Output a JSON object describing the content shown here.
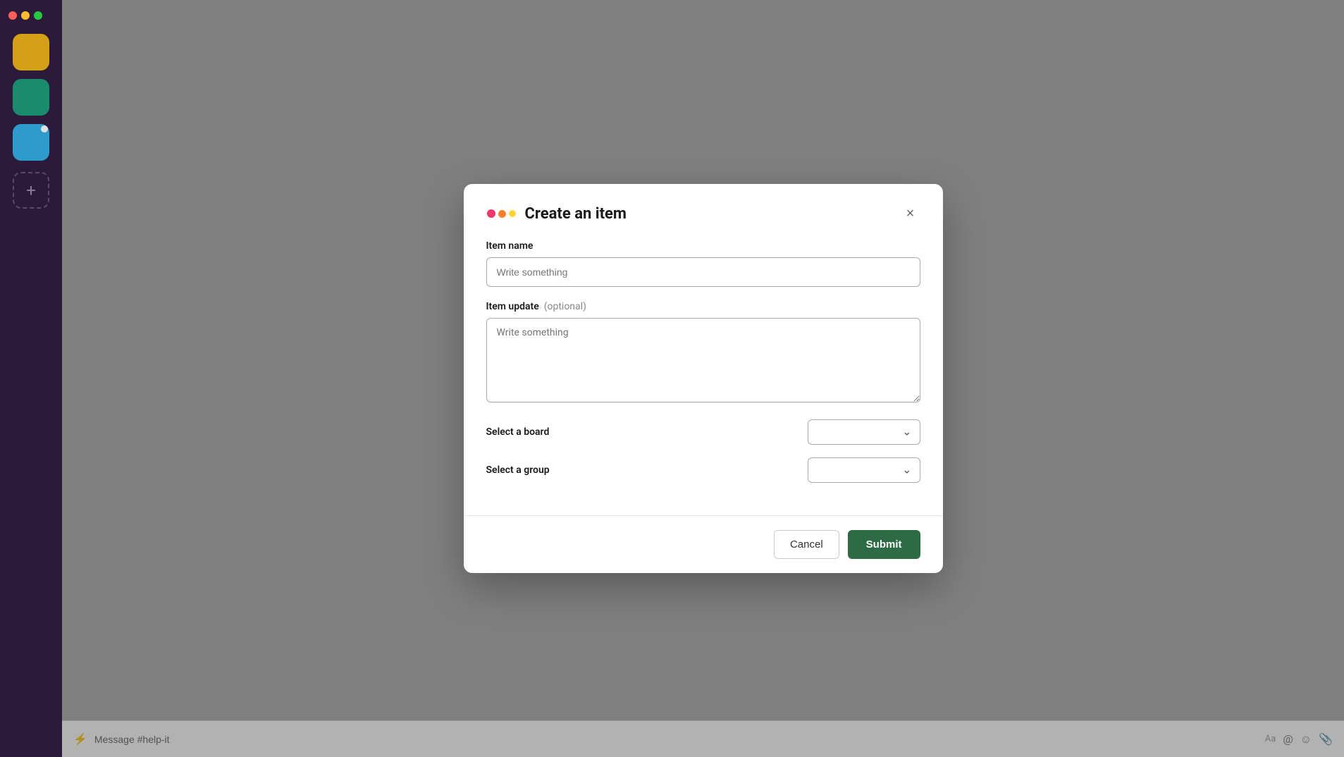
{
  "sidebar": {
    "icons": [
      {
        "id": "icon-yellow",
        "color": "yellow",
        "has_dot": false
      },
      {
        "id": "icon-teal",
        "color": "teal",
        "has_dot": false
      },
      {
        "id": "icon-blue",
        "color": "blue",
        "has_dot": true
      }
    ],
    "add_label": "+"
  },
  "dialog": {
    "title": "Create an item",
    "close_label": "×",
    "item_name_label": "Item name",
    "item_name_placeholder": "Write something",
    "item_update_label": "Item update",
    "item_update_optional": "(optional)",
    "item_update_placeholder": "Write something",
    "select_board_label": "Select a board",
    "select_group_label": "Select a group",
    "cancel_label": "Cancel",
    "submit_label": "Submit"
  },
  "chat_bar": {
    "placeholder": "Message #help-it",
    "font_icon": "Aa",
    "mention_icon": "@",
    "emoji_icon": "☺",
    "attach_icon": "📎",
    "bolt_icon": "⚡"
  }
}
